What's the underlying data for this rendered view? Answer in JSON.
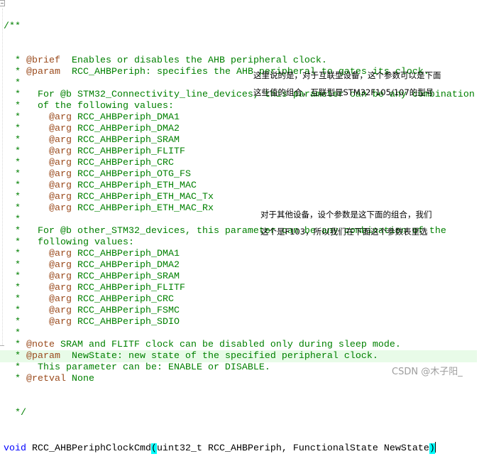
{
  "editor": {
    "comment_open": "/**",
    "comment_close": "*/",
    "lines": [
      {
        "indent": "  ",
        "star": "*",
        "tag": " @brief",
        "text": "  Enables or disables the AHB peripheral clock."
      },
      {
        "indent": "  ",
        "star": "*",
        "tag": " @param",
        "text": "  RCC_AHBPeriph: specifies the AHB peripheral to gates its clock."
      },
      {
        "indent": "  ",
        "star": "*",
        "tag": "",
        "text": ""
      },
      {
        "indent": "  ",
        "star": "*",
        "tag": "",
        "text": "   For @b STM32_Connectivity_line_devices, this parameter can be any combination"
      },
      {
        "indent": "  ",
        "star": "*",
        "tag": "",
        "text": "   of the following values:"
      },
      {
        "indent": "  ",
        "star": "*",
        "tag": "     @arg",
        "text": " RCC_AHBPeriph_DMA1"
      },
      {
        "indent": "  ",
        "star": "*",
        "tag": "     @arg",
        "text": " RCC_AHBPeriph_DMA2"
      },
      {
        "indent": "  ",
        "star": "*",
        "tag": "     @arg",
        "text": " RCC_AHBPeriph_SRAM"
      },
      {
        "indent": "  ",
        "star": "*",
        "tag": "     @arg",
        "text": " RCC_AHBPeriph_FLITF"
      },
      {
        "indent": "  ",
        "star": "*",
        "tag": "     @arg",
        "text": " RCC_AHBPeriph_CRC"
      },
      {
        "indent": "  ",
        "star": "*",
        "tag": "     @arg",
        "text": " RCC_AHBPeriph_OTG_FS"
      },
      {
        "indent": "  ",
        "star": "*",
        "tag": "     @arg",
        "text": " RCC_AHBPeriph_ETH_MAC"
      },
      {
        "indent": "  ",
        "star": "*",
        "tag": "     @arg",
        "text": " RCC_AHBPeriph_ETH_MAC_Tx"
      },
      {
        "indent": "  ",
        "star": "*",
        "tag": "     @arg",
        "text": " RCC_AHBPeriph_ETH_MAC_Rx"
      },
      {
        "indent": "  ",
        "star": "*",
        "tag": "",
        "text": ""
      },
      {
        "indent": "  ",
        "star": "*",
        "tag": "",
        "text": "   For @b other_STM32_devices, this parameter can be any combination of the"
      },
      {
        "indent": "  ",
        "star": "*",
        "tag": "",
        "text": "   following values:"
      },
      {
        "indent": "  ",
        "star": "*",
        "tag": "     @arg",
        "text": " RCC_AHBPeriph_DMA1"
      },
      {
        "indent": "  ",
        "star": "*",
        "tag": "     @arg",
        "text": " RCC_AHBPeriph_DMA2"
      },
      {
        "indent": "  ",
        "star": "*",
        "tag": "     @arg",
        "text": " RCC_AHBPeriph_SRAM"
      },
      {
        "indent": "  ",
        "star": "*",
        "tag": "     @arg",
        "text": " RCC_AHBPeriph_FLITF"
      },
      {
        "indent": "  ",
        "star": "*",
        "tag": "     @arg",
        "text": " RCC_AHBPeriph_CRC"
      },
      {
        "indent": "  ",
        "star": "*",
        "tag": "     @arg",
        "text": " RCC_AHBPeriph_FSMC"
      },
      {
        "indent": "  ",
        "star": "*",
        "tag": "     @arg",
        "text": " RCC_AHBPeriph_SDIO"
      },
      {
        "indent": "  ",
        "star": "*",
        "tag": "",
        "text": ""
      },
      {
        "indent": "  ",
        "star": "*",
        "tag": " @note",
        "text": " SRAM and FLITF clock can be disabled only during sleep mode."
      },
      {
        "indent": "  ",
        "star": "*",
        "tag": " @param",
        "text": "  NewState: new state of the specified peripheral clock."
      },
      {
        "indent": "  ",
        "star": "*",
        "tag": "",
        "text": "   This parameter can be: ENABLE or DISABLE."
      },
      {
        "indent": "  ",
        "star": "*",
        "tag": " @retval",
        "text": " None"
      }
    ],
    "signature": {
      "keyword": "void",
      "function_name": " RCC_AHBPeriphClockCmd",
      "open_paren": "(",
      "params": "uint32_t RCC_AHBPeriph, FunctionalState NewState",
      "close_paren": ")"
    }
  },
  "annotations": {
    "note1_line1": "这里说的是，对于互联型设备，这个参数可以是下面",
    "note1_line2": "这些值的组合，互联型是STM32F105/107的型号",
    "note2_line1": "对于其他设备，设个参数是这下面的组合，我们",
    "note2_line2": "这个是F103，所以我们在下面这个参数表里选"
  },
  "watermark": "CSDN @木子阳_",
  "colors": {
    "comment": "#008000",
    "doc_tag": "#9a4a1c",
    "keyword": "#0000ff",
    "current_line": "#e8fbe8",
    "brace_match": "#00ffff"
  }
}
